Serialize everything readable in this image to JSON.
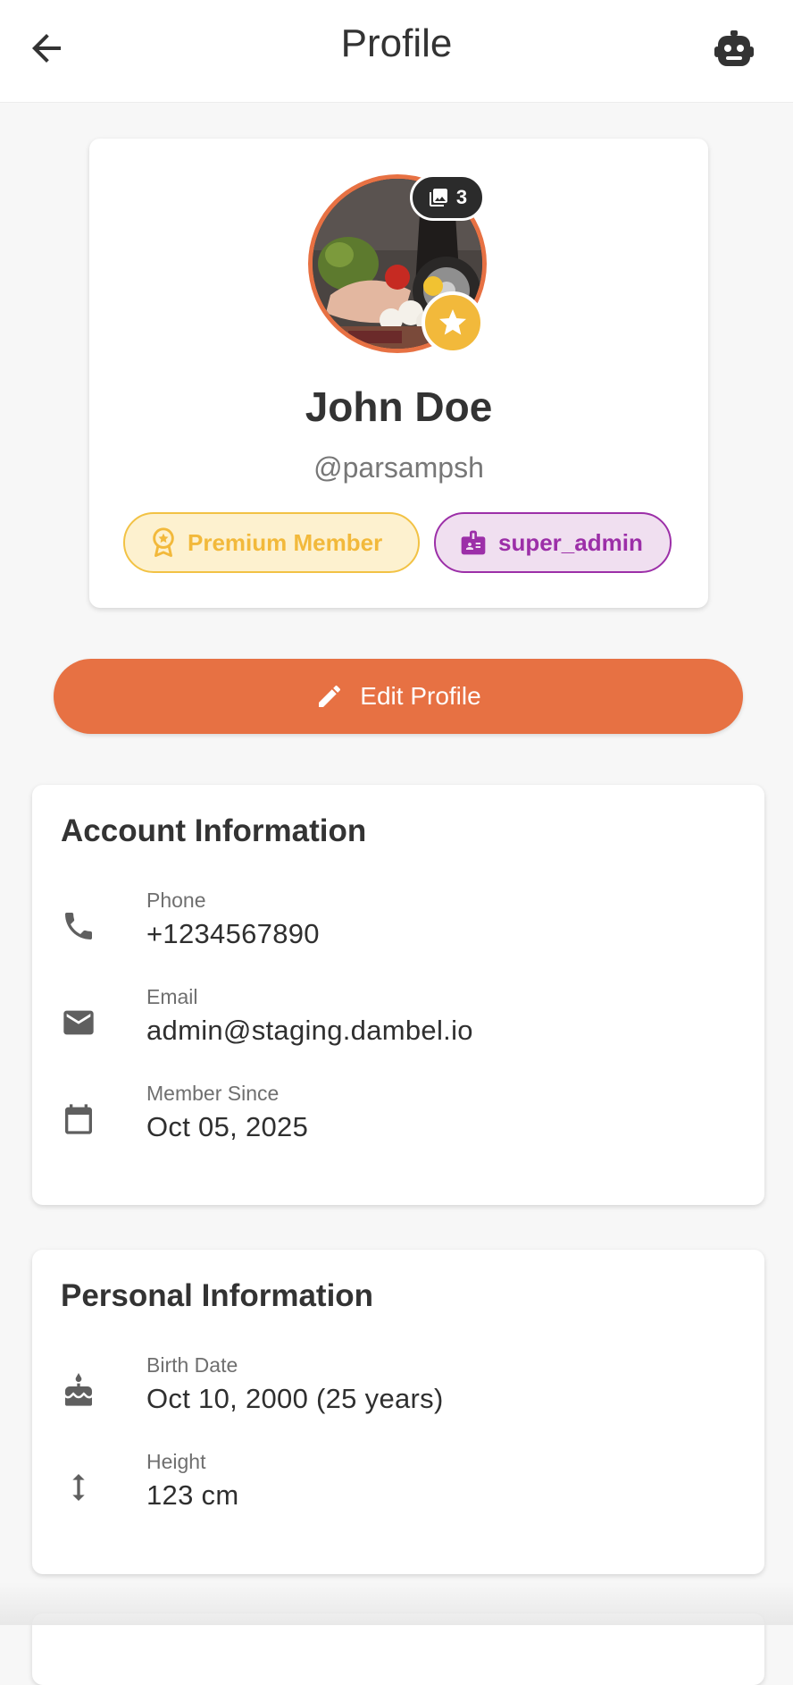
{
  "appbar": {
    "title": "Profile",
    "back_icon": "arrow-back-icon",
    "action_icon": "robot-icon"
  },
  "profile": {
    "name": "John Doe",
    "username": "@parsampsh",
    "photo_count": "3",
    "badges": {
      "premium": "Premium Member",
      "role": "super_admin"
    }
  },
  "edit_button": {
    "label": "Edit Profile"
  },
  "account_info": {
    "title": "Account Information",
    "rows": [
      {
        "label": "Phone",
        "value": "+1234567890",
        "icon": "phone-icon"
      },
      {
        "label": "Email",
        "value": "admin@staging.dambel.io",
        "icon": "email-icon"
      },
      {
        "label": "Member Since",
        "value": "Oct 05, 2025",
        "icon": "calendar-icon"
      }
    ]
  },
  "personal_info": {
    "title": "Personal Information",
    "rows": [
      {
        "label": "Birth Date",
        "value": "Oct 10, 2000 (25 years)",
        "icon": "cake-icon"
      },
      {
        "label": "Height",
        "value": "123 cm",
        "icon": "height-icon"
      }
    ]
  },
  "colors": {
    "accent": "#e77143",
    "premium": "#f2b93b",
    "admin": "#9c2fa8"
  }
}
